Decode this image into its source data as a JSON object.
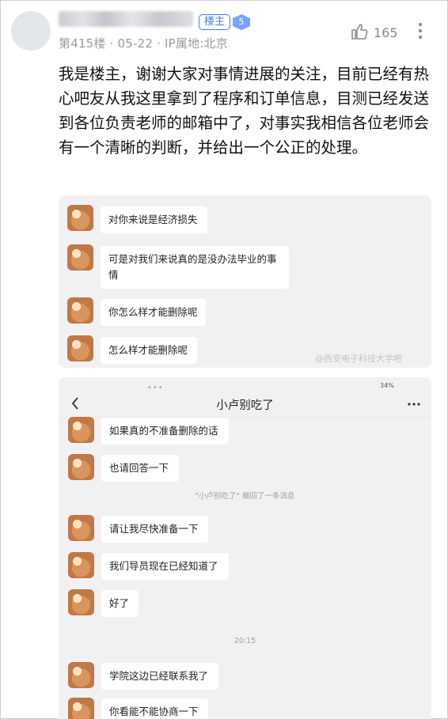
{
  "post": {
    "owner_badge": "楼主",
    "level": "5",
    "meta": "第415楼 · 05-22 · IP属地:北京",
    "like_count": "165",
    "text": "我是楼主，谢谢大家对事情进展的关注，目前已经有热心吧友从我这里拿到了程序和订单信息，目测已经发送到各位负责老师的邮箱中了，对事实我相信各位老师会有一个清晰的判断，并给出一个公正的处理。"
  },
  "screenshot1": {
    "messages": [
      "对你来说是经济损失",
      "可是对我们来说真的是没办法毕业的事情",
      "你怎么样才能删除呢",
      "怎么样才能删除呢"
    ],
    "watermark": "@西安电子科技大学吧"
  },
  "screenshot2": {
    "status": "34%",
    "chat_title": "小卢别吃了",
    "messages_a": [
      "如果真的不准备删除的话",
      "也请回答一下"
    ],
    "recall_notice": "\"小卢别吃了\" 撤回了一条消息",
    "messages_b": [
      "请让我尽快准备一下",
      "我们导员现在已经知道了",
      "好了"
    ],
    "timestamp": "20:15",
    "messages_c": [
      "学院这边已经联系我了",
      "你看能不能协商一下"
    ]
  },
  "colors": {
    "accent": "#3b7cff",
    "meta_gray": "#9a9a9a",
    "card_bg": "#f1f1f3"
  }
}
